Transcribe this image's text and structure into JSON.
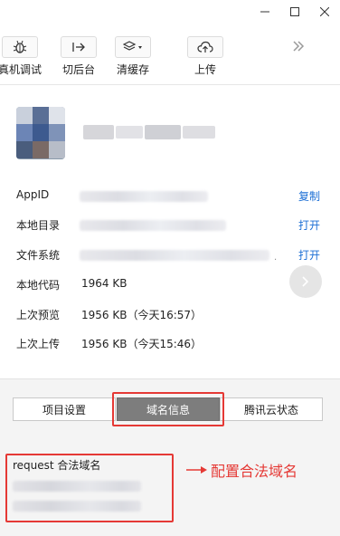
{
  "window": {
    "controls": [
      "minimize-icon",
      "maximize-icon",
      "close-icon"
    ]
  },
  "toolbar": {
    "items": [
      {
        "label": "真机调试",
        "icon": "bug-icon"
      },
      {
        "label": "切后台",
        "icon": "switch-background-icon"
      },
      {
        "label": "清缓存",
        "icon": "layers-icon"
      },
      {
        "label": "上传",
        "icon": "cloud-upload-icon"
      }
    ],
    "more_icon": "double-chevron-right-icon"
  },
  "project": {
    "avatar": "project-avatar",
    "name_obscured": true
  },
  "info": {
    "appid": {
      "label": "AppID",
      "action": "复制"
    },
    "local_dir": {
      "label": "本地目录",
      "action": "打开"
    },
    "file_system": {
      "label": "文件系统",
      "action": "打开",
      "suffix": "."
    },
    "local_code": {
      "label": "本地代码",
      "value": "1964 KB"
    },
    "last_preview": {
      "label": "上次预览",
      "value": "1956 KB（今天16:57）"
    },
    "last_upload": {
      "label": "上次上传",
      "value": "1956 KB（今天15:46）"
    }
  },
  "tabs": [
    {
      "label": "项目设置",
      "active": false
    },
    {
      "label": "域名信息",
      "active": true
    },
    {
      "label": "腾讯云状态",
      "active": false
    }
  ],
  "domain_panel": {
    "request_title": "request 合法域名"
  },
  "annotation": {
    "text": "配置合法域名",
    "color": "#e53935"
  },
  "colors": {
    "link": "#1c6fd5",
    "active_tab": "#7d7d7d",
    "highlight": "#e53935"
  }
}
